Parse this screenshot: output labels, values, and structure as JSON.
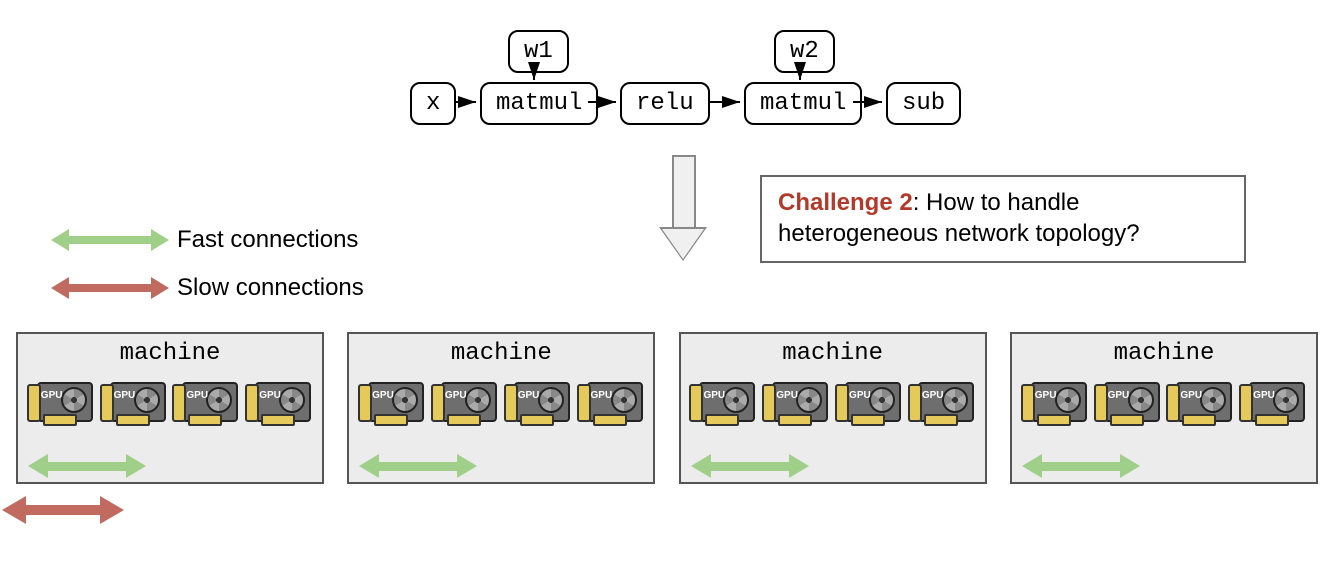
{
  "graph": {
    "nodes": {
      "x": {
        "label": "x"
      },
      "w1": {
        "label": "w1"
      },
      "mm1": {
        "label": "matmul"
      },
      "relu": {
        "label": "relu"
      },
      "w2": {
        "label": "w2"
      },
      "mm2": {
        "label": "matmul"
      },
      "sub": {
        "label": "sub"
      }
    },
    "edges": [
      [
        "x",
        "mm1"
      ],
      [
        "w1",
        "mm1"
      ],
      [
        "mm1",
        "relu"
      ],
      [
        "relu",
        "mm2"
      ],
      [
        "w2",
        "mm2"
      ],
      [
        "mm2",
        "sub"
      ]
    ]
  },
  "challenge": {
    "title": "Challenge 2",
    "text": ": How to handle heterogeneous network topology?"
  },
  "legend": {
    "fast": "Fast connections",
    "slow": "Slow connections"
  },
  "machines": {
    "label": "machine",
    "gpu_label": "GPU",
    "count": 4,
    "gpus_per_machine": 4
  },
  "colors": {
    "fast": "#a0cf8a",
    "slow": "#c16a5f",
    "challenge_title": "#b33a2a"
  }
}
